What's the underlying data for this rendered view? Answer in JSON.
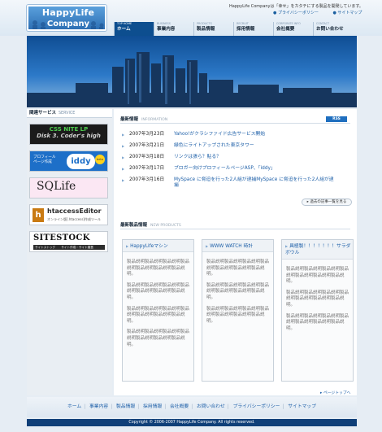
{
  "header": {
    "logo_line1": "HappyLife",
    "logo_line2": "Company",
    "tagline": "HappyLife Companyは「幸せ」をカタチにする製品を開発しています。",
    "privacy_link": "プライバシーポリシー",
    "sitemap_link": "サイトマップ"
  },
  "nav": [
    {
      "en": "TOP HOME",
      "jp": "ホーム",
      "active": true
    },
    {
      "en": "BUSINESS",
      "jp": "事業内容",
      "active": false
    },
    {
      "en": "PRODUCTS",
      "jp": "製品情報",
      "active": false
    },
    {
      "en": "RECRUIT",
      "jp": "採用情報",
      "active": false
    },
    {
      "en": "CORPORATE INFO",
      "jp": "会社概要",
      "active": false
    },
    {
      "en": "CONTACT",
      "jp": "お問い合わせ",
      "active": false
    }
  ],
  "sidebar": {
    "title": "関連サービス",
    "title_en": "SERVICE",
    "banners": {
      "b1_line1": "CSS NITE LP",
      "b1_line2": "Disk 3. Coder's high",
      "b2_line1": "プロフィール\nページ作成",
      "b2_logo": "iddy",
      "b2_badge": "beta",
      "b3_logo": "SQLife",
      "b3_sub": "",
      "b4_icon": "h",
      "b4_line1": "htaccessEditor",
      "b4_line2": "オンライン版[.htaccess]作成ツール",
      "b5_line1": "SITESTOCK",
      "b5_line2": "サイトストック　　サイト作成・サイト運営"
    }
  },
  "information": {
    "title": "最新情報",
    "title_en": "INFORMATION",
    "rss": "RSS",
    "items": [
      {
        "date": "2007年3月23日",
        "title": "Yahoo!がクラシファイド広告サービス開始"
      },
      {
        "date": "2007年3月21日",
        "title": "緑色にライトアップされた東京タワー"
      },
      {
        "date": "2007年3月18日",
        "title": "リンクは張ら？貼る？"
      },
      {
        "date": "2007年3月17日",
        "title": "ブロガー向けプロフィールページASP、「iddy」"
      },
      {
        "date": "2007年3月16日",
        "title": "MySpace に脅迫を行った2人組が逮捕MySpace に脅迫を行った2人組が逮捕"
      }
    ],
    "more_button": "過去の記事一覧を見る"
  },
  "new_products": {
    "title": "最新製品情報",
    "title_en": "NEW PRODUCTS",
    "cards": [
      {
        "name": "HappyLifeマシン",
        "paragraphs": [
          "製品説明製品説明製品説明製品説明製品説明製品説明製品説明。",
          "製品説明製品説明製品説明製品説明製品説明製品説明製品説明。",
          "製品説明製品説明製品説明製品説明製品説明製品説明製品説明。",
          "製品説明製品説明製品説明製品説明製品説明製品説明製品説明。"
        ]
      },
      {
        "name": "WWW WATCH 時計",
        "paragraphs": [
          "製品説明製品説明製品説明製品説明製品説明製品説明製品説明。",
          "製品説明製品説明製品説明製品説明製品説明製品説明製品説明。",
          "製品説明製品説明製品説明製品説明製品説明製品説明製品説明。"
        ]
      },
      {
        "name": "具極製！！！！！！！サラダボウル",
        "paragraphs": [
          "製品説明製品説明製品説明製品説明製品説明製品説明製品説明。",
          "製品説明製品説明製品説明製品説明製品説明製品説明製品説明。",
          "製品説明製品説明製品説明製品説明製品説明製品説明製品説明。"
        ]
      }
    ],
    "page_top": "ページトップへ"
  },
  "footer": {
    "links": [
      "ホーム",
      "事業内容",
      "製品情報",
      "採用情報",
      "会社概要",
      "お問い合わせ",
      "プライバシーポリシー",
      "サイトマップ"
    ],
    "copyright": "Copyright © 2006-2007 HappyLife Company. All rights reserved."
  },
  "colors": {
    "brand_blue": "#0d4e8f",
    "link_blue": "#1d5fa8",
    "footer_bar": "#0f3f78"
  }
}
